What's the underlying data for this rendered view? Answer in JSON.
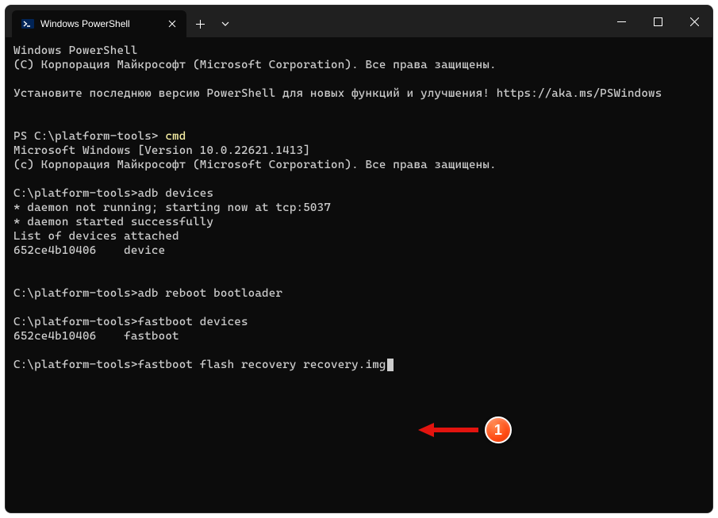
{
  "titlebar": {
    "tab_title": "Windows PowerShell"
  },
  "terminal": {
    "line1": "Windows PowerShell",
    "line2": "(C) Корпорация Майкрософт (Microsoft Corporation). Все права защищены.",
    "line3": "",
    "line4": "Установите последнюю версию PowerShell для новых функций и улучшения! https://aka.ms/PSWindows",
    "line5": "",
    "line6": "",
    "prompt1_a": "PS C:\\platform-tools> ",
    "prompt1_b": "cmd",
    "line7": "Microsoft Windows [Version 10.0.22621.1413]",
    "line8": "(c) Корпорация Майкрософт (Microsoft Corporation). Все права защищены.",
    "line9": "",
    "line10": "C:\\platform-tools>adb devices",
    "line11": "* daemon not running; starting now at tcp:5037",
    "line12": "* daemon started successfully",
    "line13": "List of devices attached",
    "line14": "652ce4b10406    device",
    "line15": "",
    "line16": "",
    "line17": "C:\\platform-tools>adb reboot bootloader",
    "line18": "",
    "line19": "C:\\platform-tools>fastboot devices",
    "line20": "652ce4b10406    fastboot",
    "line21": "",
    "line22": "C:\\platform-tools>fastboot flash recovery recovery.img"
  },
  "annotation": {
    "badge": "1"
  }
}
